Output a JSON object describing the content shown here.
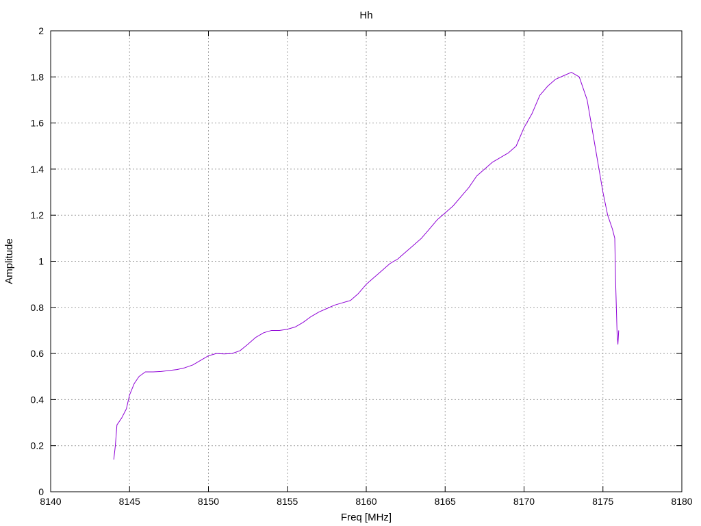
{
  "chart_data": {
    "type": "line",
    "title": "Hh",
    "xlabel": "Freq [MHz]",
    "ylabel": "Amplitude",
    "xlim": [
      8140,
      8180
    ],
    "ylim": [
      0,
      2
    ],
    "x_ticks": [
      "8140",
      "8145",
      "8150",
      "8155",
      "8160",
      "8165",
      "8170",
      "8175",
      "8180"
    ],
    "y_ticks": [
      "0",
      "0.2",
      "0.4",
      "0.6",
      "0.8",
      "1",
      "1.2",
      "1.4",
      "1.6",
      "1.8",
      "2"
    ],
    "grid": true,
    "line_color": "#8e00d6",
    "series": [
      {
        "x": [
          8144.0,
          8144.1,
          8144.2,
          8144.3,
          8144.5,
          8144.8,
          8145.0,
          8145.3,
          8145.6,
          8146.0,
          8146.5,
          8147.0,
          8147.5,
          8148.0,
          8148.5,
          8149.0,
          8149.5,
          8150.0,
          8150.5,
          8151.0,
          8151.5,
          8152.0,
          8152.5,
          8153.0,
          8153.5,
          8154.0,
          8154.5,
          8155.0,
          8155.5,
          8156.0,
          8156.5,
          8157.0,
          8157.5,
          8158.0,
          8158.5,
          8159.0,
          8159.5,
          8160.0,
          8160.5,
          8161.0,
          8161.5,
          8162.0,
          8162.5,
          8163.0,
          8163.5,
          8164.0,
          8164.5,
          8165.0,
          8165.5,
          8166.0,
          8166.5,
          8167.0,
          8167.5,
          8168.0,
          8168.5,
          8169.0,
          8169.5,
          8170.0,
          8170.5,
          8171.0,
          8171.5,
          8172.0,
          8172.5,
          8173.0,
          8173.5,
          8174.0,
          8174.5,
          8175.0,
          8175.3,
          8175.6,
          8175.75,
          8175.8,
          8175.85,
          8175.9,
          8175.95,
          8176.0
        ],
        "y": [
          0.14,
          0.2,
          0.29,
          0.3,
          0.32,
          0.36,
          0.42,
          0.47,
          0.5,
          0.52,
          0.52,
          0.522,
          0.526,
          0.53,
          0.538,
          0.55,
          0.57,
          0.59,
          0.6,
          0.598,
          0.6,
          0.612,
          0.64,
          0.67,
          0.69,
          0.7,
          0.7,
          0.705,
          0.715,
          0.735,
          0.76,
          0.78,
          0.795,
          0.81,
          0.82,
          0.83,
          0.86,
          0.9,
          0.93,
          0.96,
          0.99,
          1.01,
          1.04,
          1.07,
          1.1,
          1.14,
          1.18,
          1.21,
          1.24,
          1.28,
          1.32,
          1.37,
          1.4,
          1.43,
          1.45,
          1.47,
          1.5,
          1.58,
          1.64,
          1.72,
          1.76,
          1.79,
          1.805,
          1.82,
          1.8,
          1.7,
          1.5,
          1.3,
          1.2,
          1.14,
          1.1,
          0.92,
          0.8,
          0.68,
          0.64,
          0.7
        ]
      }
    ]
  }
}
